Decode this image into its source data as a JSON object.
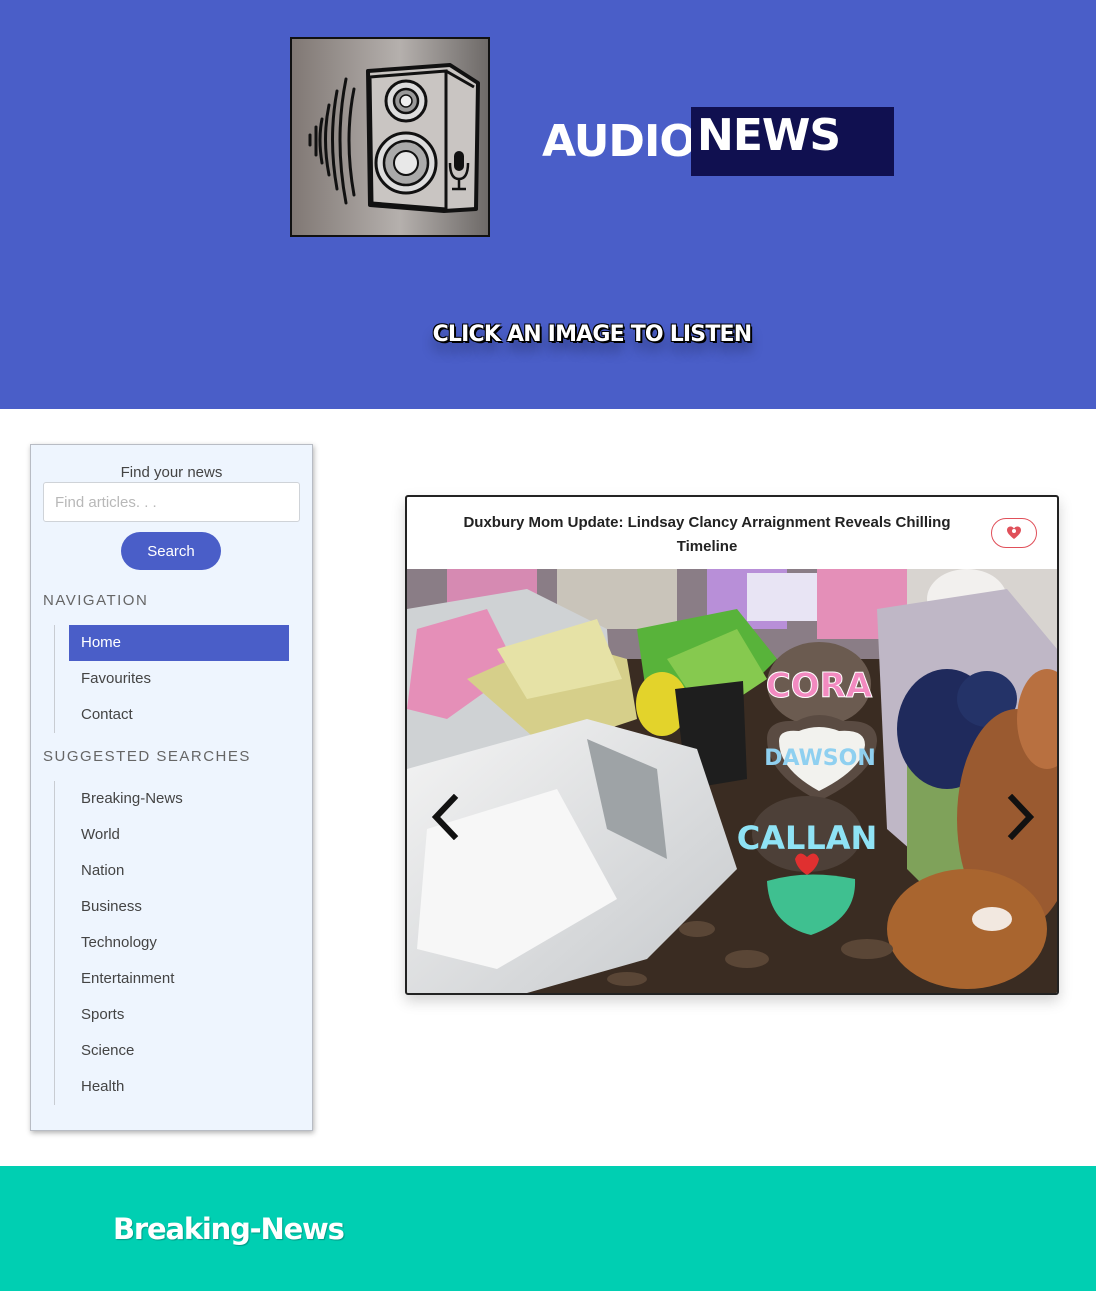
{
  "header": {
    "brand_audio": "AUDIO",
    "brand_news": "NEWS",
    "tagline": "CLICK AN IMAGE TO LISTEN",
    "logo_icon": "speaker-icon"
  },
  "sidebar": {
    "find_label": "Find your news",
    "search_placeholder": "Find articles. . .",
    "search_button": "Search",
    "navigation_heading": "NAVIGATION",
    "nav_items": [
      {
        "label": "Home",
        "active": true
      },
      {
        "label": "Favourites",
        "active": false
      },
      {
        "label": "Contact",
        "active": false
      }
    ],
    "suggested_heading": "SUGGESTED SEARCHES",
    "suggested_items": [
      {
        "label": "Breaking-News"
      },
      {
        "label": "World"
      },
      {
        "label": "Nation"
      },
      {
        "label": "Business"
      },
      {
        "label": "Technology"
      },
      {
        "label": "Entertainment"
      },
      {
        "label": "Sports"
      },
      {
        "label": "Science"
      },
      {
        "label": "Health"
      }
    ]
  },
  "carousel": {
    "article_title": "Duxbury Mom Update: Lindsay Clancy Arraignment Reveals Chilling Timeline",
    "image_stones": [
      "CORA",
      "DAWSON",
      "CALLAN"
    ],
    "favourite_icon": "heart-icon",
    "prev_icon": "chevron-left-icon",
    "next_icon": "chevron-right-icon"
  },
  "category_section": {
    "title": "Breaking-News"
  },
  "colors": {
    "primary": "#4a5ec8",
    "brand_dark": "#101050",
    "sidebar_bg": "#eef5fe",
    "category_band": "#00cfb2",
    "favourite_accent": "#e0505a"
  }
}
